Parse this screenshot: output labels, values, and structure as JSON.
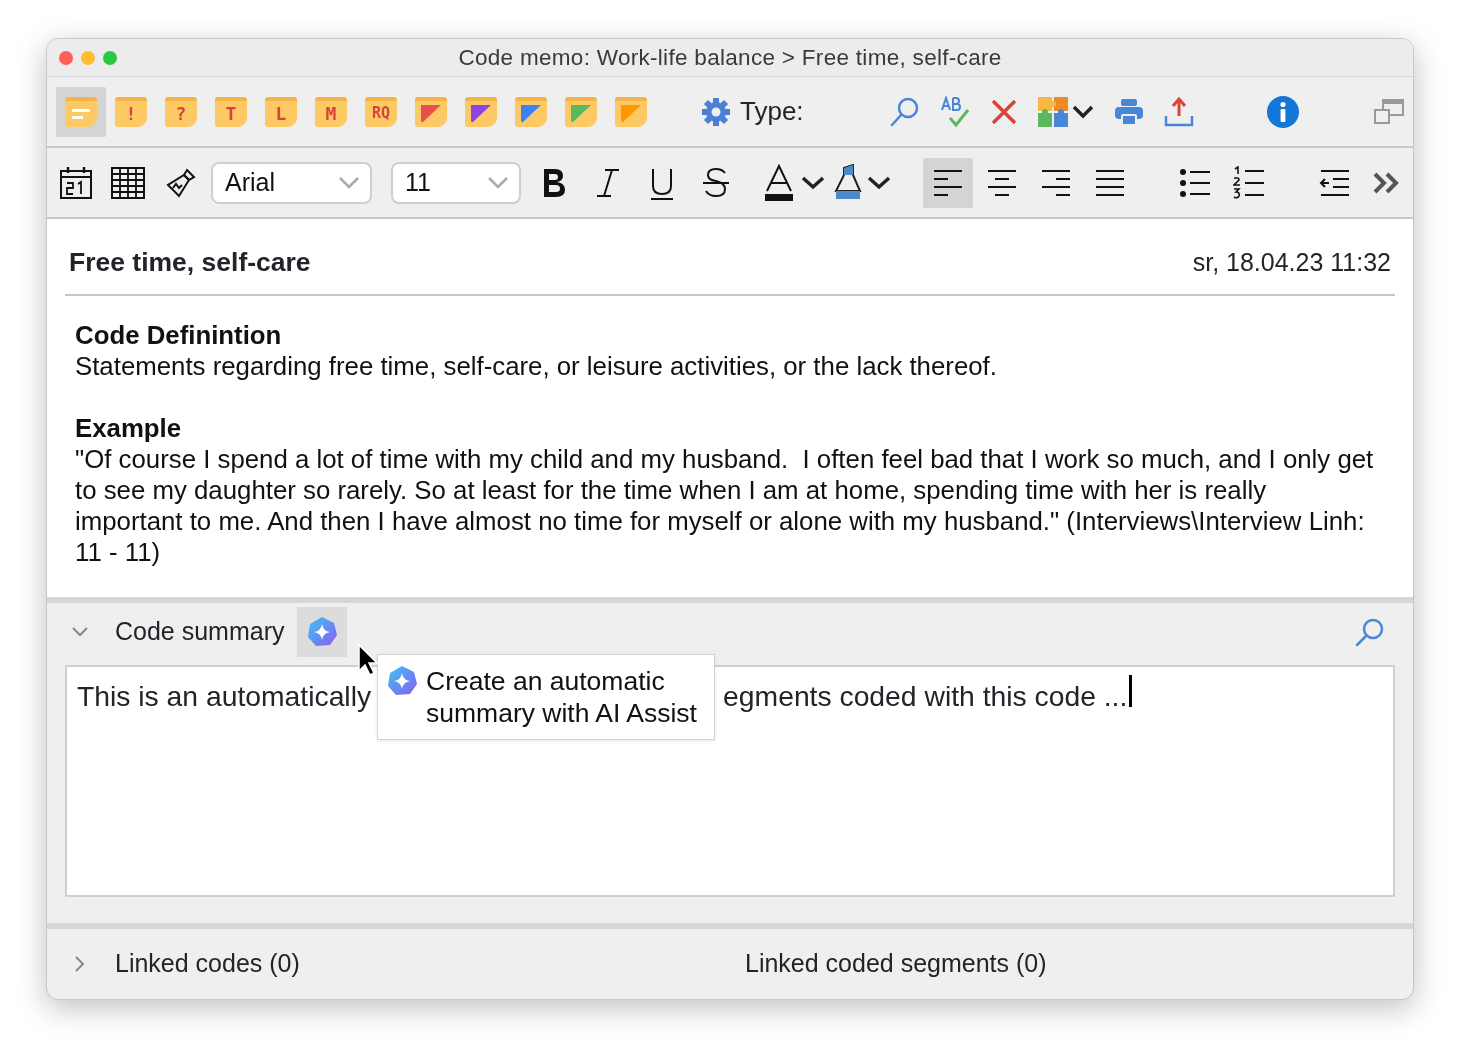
{
  "window": {
    "title": "Code memo: Work-life balance > Free time, self-care"
  },
  "memo_types": [
    {
      "kind": "lines",
      "selected": true
    },
    {
      "kind": "letter",
      "label": "!",
      "selected": false
    },
    {
      "kind": "letter",
      "label": "?",
      "selected": false
    },
    {
      "kind": "letter",
      "label": "T",
      "selected": false
    },
    {
      "kind": "letter",
      "label": "L",
      "selected": false
    },
    {
      "kind": "letter",
      "label": "M",
      "selected": false
    },
    {
      "kind": "letter",
      "label": "RQ",
      "selected": false
    },
    {
      "kind": "corner",
      "color": "#e8504a",
      "selected": false
    },
    {
      "kind": "corner",
      "color": "#8e44e0",
      "selected": false
    },
    {
      "kind": "corner",
      "color": "#3b82f6",
      "selected": false
    },
    {
      "kind": "corner",
      "color": "#5cb85c",
      "selected": false
    },
    {
      "kind": "corner",
      "color": "#ff9800",
      "selected": false
    }
  ],
  "type_label": "Type:",
  "format": {
    "font": "Arial",
    "size": "11"
  },
  "alignment": [
    {
      "kind": "left",
      "selected": true
    },
    {
      "kind": "center",
      "selected": false
    },
    {
      "kind": "right",
      "selected": false
    },
    {
      "kind": "justify",
      "selected": false
    }
  ],
  "memo": {
    "title": "Free time, self-care",
    "date": "sr, 18.04.23 11:32",
    "paragraphs": [
      {
        "heading": "Code Definintion",
        "text": "Statements regarding free time, self-care, or leisure activities, or the lack thereof."
      },
      {
        "heading": "Example",
        "text": "\"Of course I spend a lot of time with my child and my husband.  I often feel bad that I work so much, and I only get to see my daughter so rarely. So at least for the time when I am at home, spending time with her is really important to me. And then I have almost no time for myself or alone with my husband.\" (Interviews\\Interview Linh: 11 - 11)"
      }
    ]
  },
  "summary": {
    "title": "Code summary",
    "expanded": true,
    "text_before": "This is an automatically",
    "text_after": "egments coded with this code ...",
    "tooltip": "Create an automatic summary with AI Assist"
  },
  "linked": {
    "expanded": false,
    "codes": "Linked codes (0)",
    "segments": "Linked coded segments (0)"
  }
}
